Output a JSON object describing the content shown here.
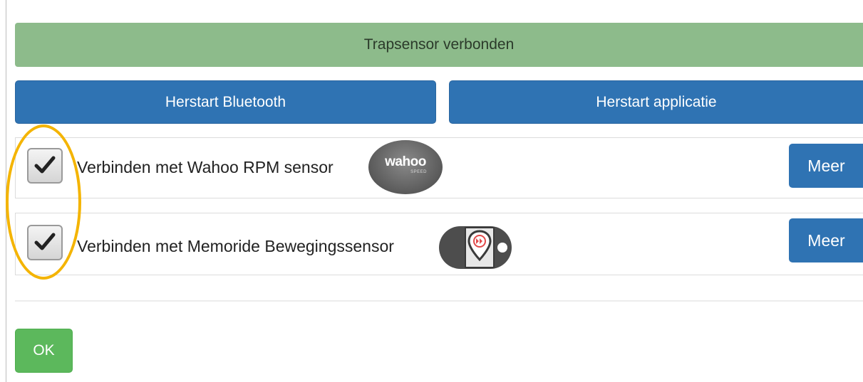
{
  "status": {
    "text": "Trapsensor verbonden",
    "color": "#8dbb8b"
  },
  "actions": {
    "restart_bluetooth": "Herstart Bluetooth",
    "restart_app": "Herstart applicatie"
  },
  "sensors": [
    {
      "label": "Verbinden met Wahoo RPM sensor",
      "checked": true,
      "logo": {
        "name": "wahoo-logo",
        "text": "wahoo",
        "subtext": "SPEED"
      },
      "more_label": "Meer"
    },
    {
      "label": "Verbinden met Memoride Bewegingssensor",
      "checked": true,
      "logo": {
        "name": "memoride-logo"
      },
      "more_label": "Meer"
    }
  ],
  "footer": {
    "ok_label": "OK"
  },
  "annotation": {
    "color": "#f4b400",
    "shape": "ellipse"
  },
  "colors": {
    "primary": "#2f73b3",
    "success": "#5cb85c"
  }
}
